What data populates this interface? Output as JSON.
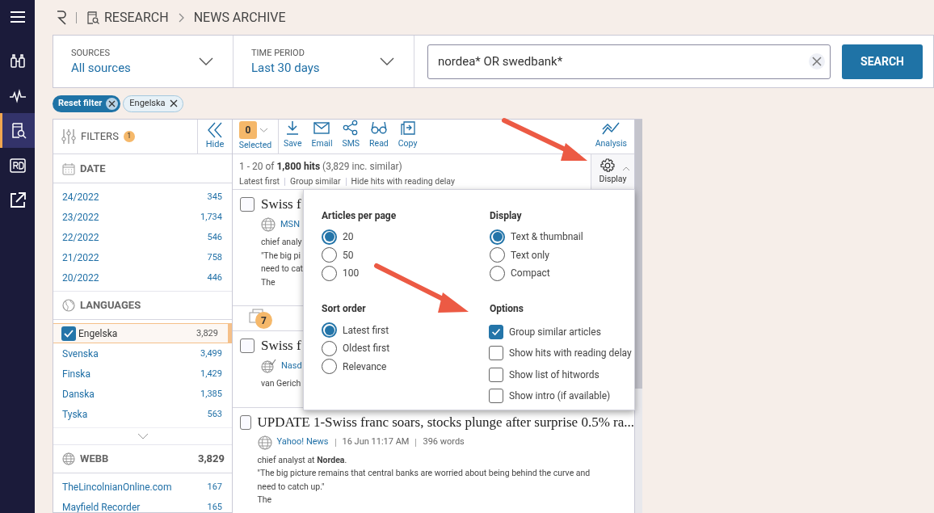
{
  "nav": [
    {
      "selected": false
    },
    {
      "selected": false
    },
    {
      "selected": true
    },
    {
      "selected": false
    },
    {
      "selected": false
    }
  ],
  "breadcrumb": [
    "RESEARCH",
    "NEWS ARCHIVE"
  ],
  "sources": {
    "label": "SOURCES",
    "value": "All sources"
  },
  "time_period": {
    "label": "TIME PERIOD",
    "value": "Last 30 days"
  },
  "search": {
    "value": "nordea* OR swedbank*",
    "button": "SEARCH"
  },
  "chips": [
    {
      "label": "Reset filter",
      "kind": "reset"
    },
    {
      "label": "Engelska",
      "kind": "filter"
    }
  ],
  "filters": {
    "title": "FILTERS",
    "count": "1",
    "hide": "Hide",
    "sections": [
      {
        "title": "DATE",
        "kind": "date",
        "items": [
          {
            "label": "24/2022",
            "count": "345"
          },
          {
            "label": "23/2022",
            "count": "1,734"
          },
          {
            "label": "22/2022",
            "count": "546"
          },
          {
            "label": "21/2022",
            "count": "758"
          },
          {
            "label": "20/2022",
            "count": "446"
          }
        ]
      },
      {
        "title": "LANGUAGES",
        "kind": "languages",
        "more": true,
        "items": [
          {
            "label": "Engelska",
            "count": "3,829",
            "checked": true
          },
          {
            "label": "Svenska",
            "count": "3,499",
            "checked": false
          },
          {
            "label": "Finska",
            "count": "1,429",
            "checked": false
          },
          {
            "label": "Danska",
            "count": "1,385",
            "checked": false
          },
          {
            "label": "Tyska",
            "count": "563",
            "checked": false
          }
        ]
      },
      {
        "title": "WEBB",
        "kind": "web",
        "count": "3,829",
        "items": [
          {
            "label": "TheLincolnianOnline.com",
            "count": "167"
          },
          {
            "label": "Mayfield Recorder",
            "count": "165"
          }
        ]
      }
    ]
  },
  "toolbar": {
    "selected_count": "0",
    "selected_label": "Selected",
    "actions": [
      "Save",
      "Email",
      "SMS",
      "Read",
      "Copy"
    ],
    "analysis": "Analysis"
  },
  "hits": {
    "summary": "1 - 20 of **1,800 hits** (3,829 inc. similar)",
    "settings": [
      "Latest first",
      "Group similar",
      "Hide hits with reading delay"
    ],
    "display": "Display"
  },
  "articles": [
    {
      "kind": "article",
      "checked": false,
      "title": "Swiss f",
      "source_verified": false,
      "meta": [
        "MSN"
      ],
      "lines": [
        "chief analy",
        "\"The big pi",
        "need to cat",
        "The"
      ]
    },
    {
      "kind": "similar",
      "count": "7"
    },
    {
      "kind": "article",
      "checked": false,
      "title": "Swiss f",
      "source_verified": true,
      "meta": [
        "Nasd"
      ],
      "lines": [
        "van Gerich"
      ]
    },
    {
      "kind": "article",
      "checked": false,
      "title": "UPDATE 1-Swiss franc soars, stocks plunge after surprise 0.5% ra...",
      "source_verified": false,
      "meta": [
        "Yahoo! News",
        "16 Jun 11:17 AM",
        "396 words"
      ],
      "lines": [
        "chief analyst at **Nordea**.",
        "\"The big picture remains that central banks are worried about being behind the curve and",
        "need to catch up.\"",
        "The"
      ]
    }
  ],
  "display_popup": {
    "groups": [
      {
        "title": "Articles per page",
        "kind": "radio",
        "options": [
          {
            "label": "20",
            "selected": true
          },
          {
            "label": "50",
            "selected": false
          },
          {
            "label": "100",
            "selected": false
          }
        ]
      },
      {
        "title": "Display",
        "kind": "radio",
        "options": [
          {
            "label": "Text & thumbnail",
            "selected": true
          },
          {
            "label": "Text only",
            "selected": false
          },
          {
            "label": "Compact",
            "selected": false
          }
        ]
      },
      {
        "title": "Sort order",
        "kind": "radio",
        "options": [
          {
            "label": "Latest first",
            "selected": true
          },
          {
            "label": "Oldest first",
            "selected": false
          },
          {
            "label": "Relevance",
            "selected": false
          }
        ]
      },
      {
        "title": "Options",
        "kind": "checkbox",
        "options": [
          {
            "label": "Group similar articles",
            "checked": true
          },
          {
            "label": "Show hits with reading delay",
            "checked": false
          },
          {
            "label": "Show list of hitwords",
            "checked": false
          },
          {
            "label": "Show intro (if available)",
            "checked": false
          }
        ]
      }
    ]
  }
}
